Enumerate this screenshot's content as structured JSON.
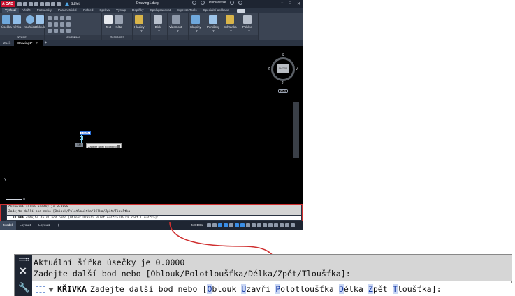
{
  "app": {
    "logo": "A CAD",
    "share_label": "Sdílet",
    "document_title": "Drawing1.dwg",
    "sign_in_label": "Přihlásit se",
    "window_controls": [
      "−",
      "□",
      "✕"
    ]
  },
  "ribbon": {
    "tabs": [
      "Výchozí",
      "Vložit",
      "Poznámky",
      "Parametrické",
      "Pohled",
      "Správa",
      "Výstup",
      "Doplňky",
      "Spolupracovat",
      "Express Tools",
      "Speciální aplikace"
    ],
    "active_tab": "Výchozí",
    "panels": [
      {
        "title": "Kreslit",
        "buttons": [
          "Úsečka",
          "Křivka",
          "Kružnice",
          "Oblouk"
        ]
      },
      {
        "title": "Modifikace",
        "buttons": []
      },
      {
        "title": "Poznámka",
        "buttons": [
          "Text",
          "Kóta"
        ]
      },
      {
        "title": "",
        "buttons": [
          "Hladiny"
        ]
      },
      {
        "title": "",
        "buttons": [
          "Blok"
        ]
      },
      {
        "title": "",
        "buttons": [
          "Vlastnosti"
        ]
      },
      {
        "title": "",
        "buttons": [
          "Skupiny"
        ]
      },
      {
        "title": "",
        "buttons": [
          "Pomůcky"
        ]
      },
      {
        "title": "",
        "buttons": [
          "Schránka"
        ]
      },
      {
        "title": "",
        "buttons": [
          "Pohled"
        ]
      }
    ]
  },
  "file_tabs": {
    "items": [
      "Začít",
      "Drawing1*"
    ],
    "active": "Drawing1*",
    "close_glyph": "✕",
    "add_glyph": "+"
  },
  "viewcube": {
    "face": "SHORA",
    "north": "S",
    "south": "J",
    "west": "Z",
    "east": "V",
    "wcs": "WCS"
  },
  "canvas": {
    "dynamic_input_value": "0.0000",
    "snap_chip": "SM",
    "tooltip": "Zadejte další bod nebo",
    "ucs_x": "X",
    "ucs_y": "Y"
  },
  "command_line": {
    "history": [
      "Aktuální šířka úsečky je 0.0000",
      "Zadejte další bod nebo [Oblouk/Polotloušťka/Délka/Zpět/Tloušťka]:"
    ],
    "command_name": "KŘIVKA",
    "prompt": "Zadejte další bod nebo",
    "options": [
      {
        "hotkey": "O",
        "rest": "blouk"
      },
      {
        "hotkey": "U",
        "rest": "zavři"
      },
      {
        "hotkey": "P",
        "rest": "olotloušťka"
      },
      {
        "hotkey": "D",
        "rest": "élka"
      },
      {
        "hotkey": "Z",
        "rest": "pět"
      },
      {
        "hotkey": "T",
        "rest": "loušťka"
      }
    ],
    "prefix": "[",
    "suffix": "]:",
    "close_glyph": "✕",
    "wrench_glyph": "🔧"
  },
  "status_bar": {
    "layout_tabs": [
      "Model",
      "Layout1",
      "Layout2"
    ],
    "active_tab": "Model",
    "add_glyph": "+",
    "model_label": "MODEL"
  },
  "colors": {
    "highlight_border": "#d03030",
    "hotkey_bg": "#c9d6f4",
    "accent": "#3a8ee6"
  }
}
